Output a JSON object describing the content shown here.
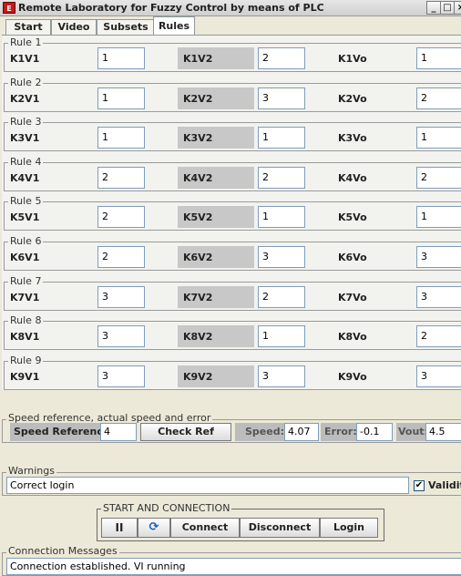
{
  "window": {
    "icon_text": "E",
    "title": "Remote Laboratory for Fuzzy Control by means of PLC",
    "minimize_icon": "_",
    "maximize_icon": "□",
    "close_icon": "×"
  },
  "tabs": [
    {
      "label": "Start"
    },
    {
      "label": "Video"
    },
    {
      "label": "Subsets"
    },
    {
      "label": "Rules",
      "active": true
    }
  ],
  "rules": [
    {
      "title": "Rule 1",
      "v1_label": "K1V1",
      "v1": "1",
      "v2_label": "K1V2",
      "v2": "2",
      "vo_label": "K1Vo",
      "vo": "1"
    },
    {
      "title": "Rule 2",
      "v1_label": "K2V1",
      "v1": "1",
      "v2_label": "K2V2",
      "v2": "3",
      "vo_label": "K2Vo",
      "vo": "2"
    },
    {
      "title": "Rule 3",
      "v1_label": "K3V1",
      "v1": "1",
      "v2_label": "K3V2",
      "v2": "1",
      "vo_label": "K3Vo",
      "vo": "1"
    },
    {
      "title": "Rule 4",
      "v1_label": "K4V1",
      "v1": "2",
      "v2_label": "K4V2",
      "v2": "2",
      "vo_label": "K4Vo",
      "vo": "2"
    },
    {
      "title": "Rule 5",
      "v1_label": "K5V1",
      "v1": "2",
      "v2_label": "K5V2",
      "v2": "1",
      "vo_label": "K5Vo",
      "vo": "1"
    },
    {
      "title": "Rule 6",
      "v1_label": "K6V1",
      "v1": "2",
      "v2_label": "K6V2",
      "v2": "3",
      "vo_label": "K6Vo",
      "vo": "3"
    },
    {
      "title": "Rule 7",
      "v1_label": "K7V1",
      "v1": "3",
      "v2_label": "K7V2",
      "v2": "2",
      "vo_label": "K7Vo",
      "vo": "3"
    },
    {
      "title": "Rule 8",
      "v1_label": "K8V1",
      "v1": "3",
      "v2_label": "K8V2",
      "v2": "1",
      "vo_label": "K8Vo",
      "vo": "2"
    },
    {
      "title": "Rule 9",
      "v1_label": "K9V1",
      "v1": "3",
      "v2_label": "K9V2",
      "v2": "3",
      "vo_label": "K9Vo",
      "vo": "3"
    }
  ],
  "speed_panel": {
    "title": "Speed reference, actual speed and error",
    "ref_label": "Speed Reference:",
    "ref_value": "4",
    "check_button": "Check Ref",
    "speed_label": "Speed:",
    "speed_value": "4.07",
    "error_label": "Error:",
    "error_value": "-0.1",
    "vout_label": "Vout:",
    "vout_value": "4.5"
  },
  "warnings": {
    "title": "Warnings",
    "message": "Correct login",
    "validity_label": "Validity",
    "validity_checked": true
  },
  "start_connection": {
    "title": "START AND CONNECTION",
    "pause_icon": "pause-icon",
    "refresh_icon": "refresh-icon",
    "connect": "Connect",
    "disconnect": "Disconnect",
    "login": "Login"
  },
  "connection_messages": {
    "title": "Connection Messages",
    "message": "Connection established. VI running"
  },
  "colors": {
    "window_bg": "#ece9d8",
    "label_grey": "#c8c8c8",
    "field_border": "#7f9db9"
  }
}
